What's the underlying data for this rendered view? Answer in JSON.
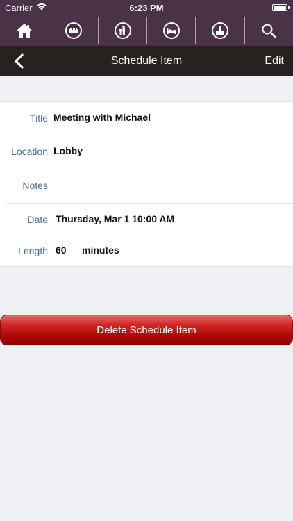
{
  "status_bar": {
    "carrier": "Carrier",
    "time": "6:23 PM",
    "battery_level": 1.0
  },
  "toolbar": {
    "icons": [
      {
        "name": "home-icon"
      },
      {
        "name": "sofa-icon"
      },
      {
        "name": "podium-speaker-icon"
      },
      {
        "name": "bed-icon"
      },
      {
        "name": "front-desk-icon"
      },
      {
        "name": "search-icon"
      }
    ]
  },
  "nav": {
    "title": "Schedule Item",
    "edit_label": "Edit"
  },
  "form": {
    "title_label": "Title",
    "title_value": "Meeting with Michael",
    "location_label": "Location",
    "location_value": "Lobby",
    "notes_label": "Notes",
    "notes_value": "",
    "date_label": "Date",
    "date_value": "Thursday, Mar 1 10:00 AM",
    "length_label": "Length",
    "length_value": "60",
    "length_unit": "minutes"
  },
  "delete_button_label": "Delete Schedule Item",
  "colors": {
    "toolbar_bg": "#4a3346",
    "navbar_bg": "#26221f",
    "label_blue": "#4a6a97",
    "delete_red": "#c01212"
  }
}
